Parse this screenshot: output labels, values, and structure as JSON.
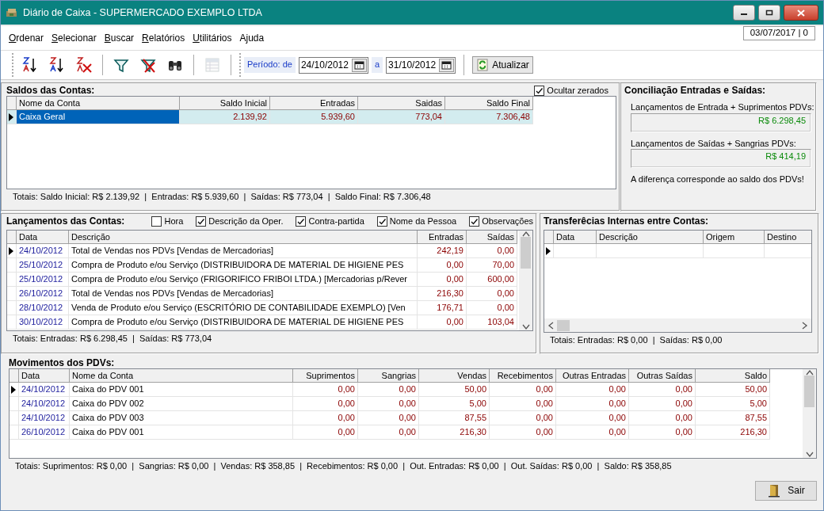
{
  "window": {
    "title": "Diário de Caixa - SUPERMERCADO EXEMPLO LTDA"
  },
  "menu": [
    {
      "label": "Ordenar",
      "mnemonic": true
    },
    {
      "label": "Selecionar",
      "mnemonic": true
    },
    {
      "label": "Buscar",
      "mnemonic": true
    },
    {
      "label": "Relatórios",
      "mnemonic": true
    },
    {
      "label": "Utilitários",
      "mnemonic": true
    },
    {
      "label": "Ajuda",
      "mnemonic": false
    }
  ],
  "date_box": "03/07/2017 | 0",
  "toolbar": {
    "tools": [
      {
        "kind": "sort-asc",
        "disabled": false
      },
      {
        "kind": "sort-desc",
        "disabled": false
      },
      {
        "kind": "sort-clear",
        "disabled": false
      },
      {
        "kind": "sep"
      },
      {
        "kind": "filter",
        "disabled": false
      },
      {
        "kind": "filter-clear",
        "disabled": false
      },
      {
        "kind": "find",
        "disabled": false
      },
      {
        "kind": "sep"
      },
      {
        "kind": "grid",
        "disabled": true
      }
    ],
    "period": {
      "label": "Período: de",
      "from": "24/10/2012",
      "to_label": "a",
      "to": "31/10/2012"
    },
    "refresh_button": "Atualizar"
  },
  "saldos": {
    "title": "Saldos das Contas:",
    "hide_zero": {
      "label": "Ocultar zerados",
      "checked": true
    },
    "columns": [
      "Nome da Conta",
      "Saldo Inicial",
      "Entradas",
      "Saidas",
      "Saldo Final"
    ],
    "rows": [
      {
        "current": true,
        "selected": true,
        "cells": [
          "Caixa Geral",
          "2.139,92",
          "5.939,60",
          "773,04",
          "7.306,48"
        ]
      }
    ],
    "totals": "Totais: Saldo Inicial: R$ 2.139,92  |  Entradas: R$ 5.939,60  |  Saídas: R$ 773,04  |  Saldo Final: R$ 7.306,48"
  },
  "conciliacao": {
    "title": "Conciliação Entradas e Saídas:",
    "items": [
      {
        "label": "Lançamentos de Entrada + Suprimentos PDVs:",
        "value": "R$ 6.298,45"
      },
      {
        "label": "Lançamentos de Saídas + Sangrias PDVs:",
        "value": "R$ 414,19"
      }
    ],
    "note": "A diferença corresponde ao saldo dos PDVs!"
  },
  "lancamentos": {
    "title": "Lançamentos das Contas:",
    "options": [
      {
        "label": "Hora",
        "checked": false
      },
      {
        "label": "Descrição da Oper.",
        "checked": true
      },
      {
        "label": "Contra-partida",
        "checked": true
      },
      {
        "label": "Nome da Pessoa",
        "checked": true
      },
      {
        "label": "Observações",
        "checked": true
      }
    ],
    "columns": [
      "Data",
      "Descrição",
      "Entradas",
      "Saídas"
    ],
    "rows": [
      {
        "current": true,
        "cells": [
          "24/10/2012",
          "Total de Vendas nos PDVs [Vendas de Mercadorias]",
          "242,19",
          "0,00"
        ]
      },
      {
        "current": false,
        "cells": [
          "25/10/2012",
          "Compra de Produto e/ou Serviço (DISTRIBUIDORA DE MATERIAL DE HIGIENE PES",
          "0,00",
          "70,00"
        ]
      },
      {
        "current": false,
        "cells": [
          "25/10/2012",
          "Compra de Produto e/ou Serviço (FRIGORIFICO FRIBOI LTDA.) [Mercadorias p/Rever",
          "0,00",
          "600,00"
        ]
      },
      {
        "current": false,
        "cells": [
          "26/10/2012",
          "Total de Vendas nos PDVs [Vendas de Mercadorias]",
          "216,30",
          "0,00"
        ]
      },
      {
        "current": false,
        "cells": [
          "28/10/2012",
          "Venda de Produto e/ou Serviço (ESCRITÓRIO DE CONTABILIDADE EXEMPLO) [Ven",
          "176,71",
          "0,00"
        ]
      },
      {
        "current": false,
        "cells": [
          "30/10/2012",
          "Compra de Produto e/ou Serviço (DISTRIBUIDORA DE MATERIAL DE HIGIENE PES",
          "0,00",
          "103,04"
        ]
      }
    ],
    "totals": "Totais: Entradas: R$ 6.298,45  |  Saídas: R$ 773,04"
  },
  "transferencias": {
    "title": "Transferêcias Internas entre Contas:",
    "columns": [
      "Data",
      "Descrição",
      "Origem",
      "Destino"
    ],
    "new_row": {
      "current": true
    },
    "totals": "Totais: Entradas: R$ 0,00  |  Saídas: R$ 0,00"
  },
  "movimentos": {
    "title": "Movimentos dos PDVs:",
    "columns": [
      "Data",
      "Nome da Conta",
      "Suprimentos",
      "Sangrias",
      "Vendas",
      "Recebimentos",
      "Outras Entradas",
      "Outras Saídas",
      "Saldo"
    ],
    "rows": [
      {
        "current": true,
        "cells": [
          "24/10/2012",
          "Caixa do PDV 001",
          "0,00",
          "0,00",
          "50,00",
          "0,00",
          "0,00",
          "0,00",
          "50,00"
        ]
      },
      {
        "current": false,
        "cells": [
          "24/10/2012",
          "Caixa do PDV 002",
          "0,00",
          "0,00",
          "5,00",
          "0,00",
          "0,00",
          "0,00",
          "5,00"
        ]
      },
      {
        "current": false,
        "cells": [
          "24/10/2012",
          "Caixa do PDV 003",
          "0,00",
          "0,00",
          "87,55",
          "0,00",
          "0,00",
          "0,00",
          "87,55"
        ]
      },
      {
        "current": false,
        "cells": [
          "26/10/2012",
          "Caixa do PDV 001",
          "0,00",
          "0,00",
          "216,30",
          "0,00",
          "0,00",
          "0,00",
          "216,30"
        ]
      }
    ],
    "totals": "Totais: Suprimentos: R$ 0,00  |  Sangrias: R$ 0,00  |  Vendas: R$ 358,85  |  Recebimentos: R$ 0,00  |  Out. Entradas: R$ 0,00  |  Out. Saídas: R$ 0,00  |  Saldo: R$ 358,85"
  },
  "exit_button": "Sair"
}
